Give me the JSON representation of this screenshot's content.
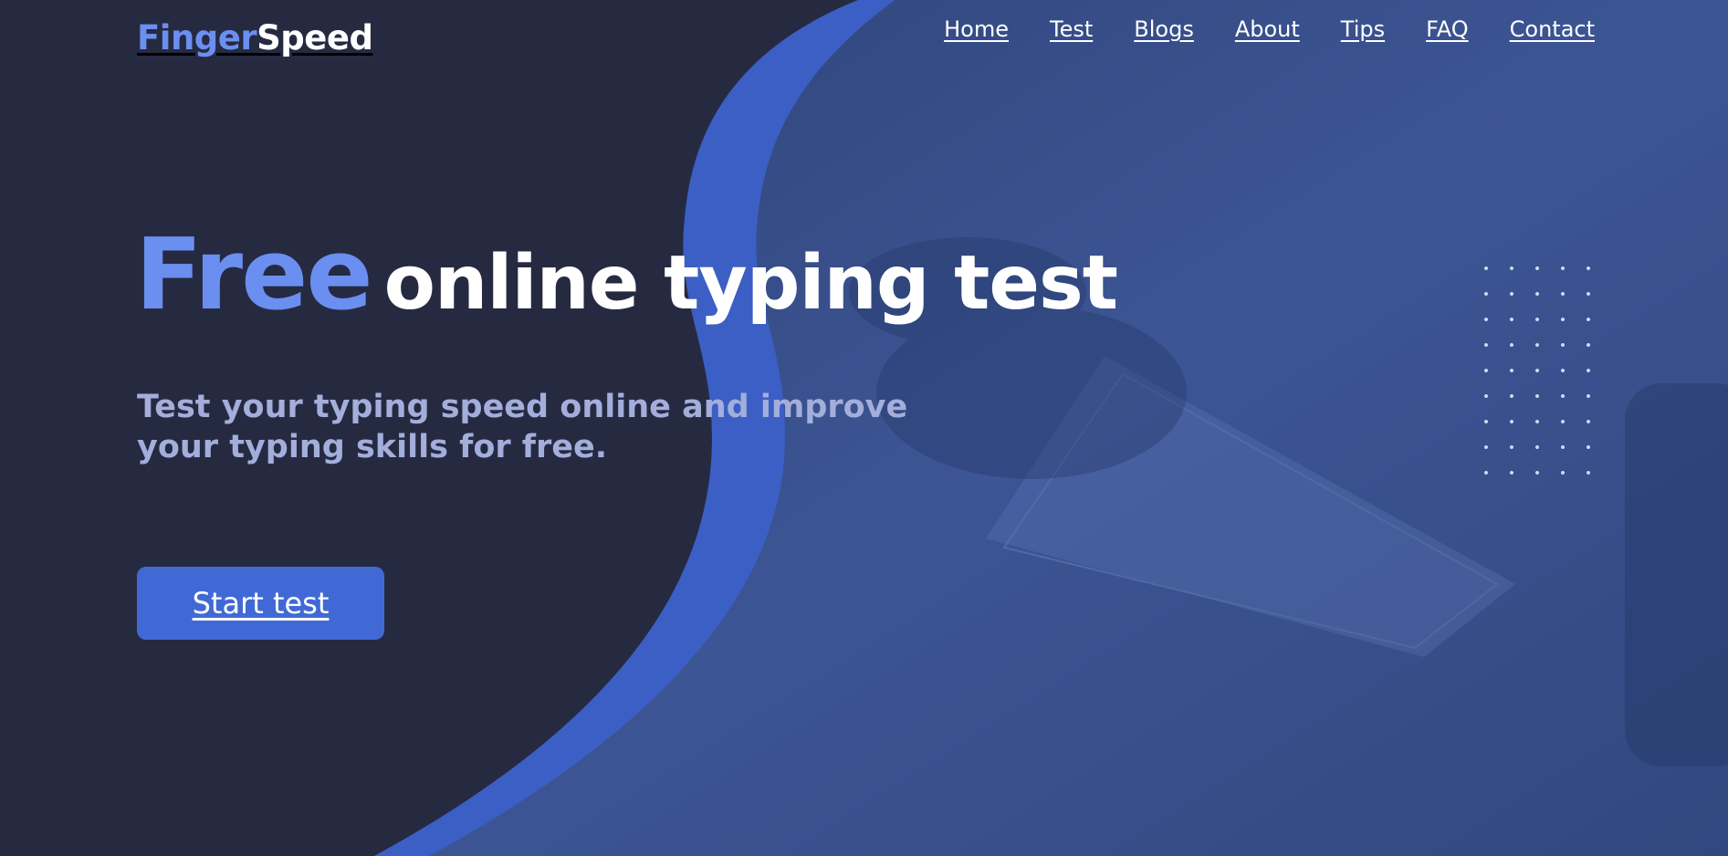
{
  "brand": {
    "part_a": "Finger",
    "part_b": "Speed"
  },
  "nav": {
    "items": [
      "Home",
      "Test",
      "Blogs",
      "About",
      "Tips",
      "FAQ",
      "Contact"
    ]
  },
  "hero": {
    "headline_a": "Free",
    "headline_b": "online typing test",
    "subtitle": "Test your typing speed online and improve your typing skills for free.",
    "cta_label": "Start test"
  },
  "colors": {
    "background": "#262a41",
    "accent": "#6b8ff0",
    "button": "#4169d6",
    "curve": "#3b5fc4",
    "photo_overlay": "#3a5290"
  }
}
